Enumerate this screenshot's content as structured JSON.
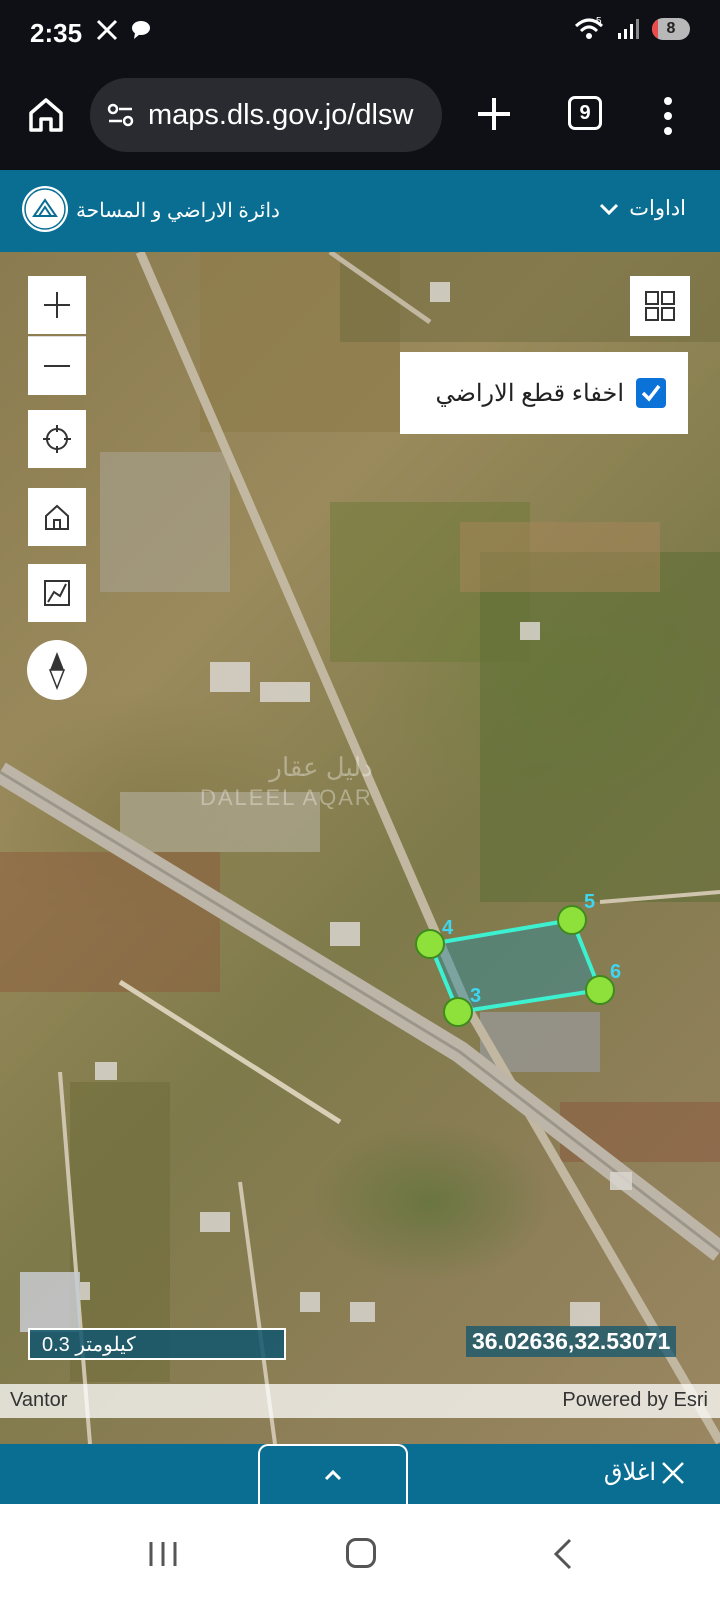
{
  "status_bar": {
    "time": "2:35",
    "icons": [
      "x-icon",
      "chat-icon"
    ],
    "wifi_label": "5",
    "battery": "8"
  },
  "browser": {
    "url": "maps.dls.gov.jo/dlsw",
    "tab_count": "9"
  },
  "header": {
    "department_name": "دائرة الاراضي و المساحة",
    "tools_label": "اداوات"
  },
  "map": {
    "layer_toggle": {
      "label": "اخفاء قطع الاراضي",
      "checked": true
    },
    "parcel_vertices": [
      "4",
      "5",
      "6",
      "3"
    ],
    "watermark_ar": "دليل عقار",
    "watermark_en": "DALEEL AQAR",
    "scale_label": "0.3 كيلومتر",
    "coordinates": "36.02636,32.53071",
    "attribution_left": "Vantor",
    "attribution_right": "Powered by Esri"
  },
  "bottom_panel": {
    "close_label": "اغلاق"
  },
  "colors": {
    "header_blue": "#0a6e93",
    "parcel_outline": "#3cf0d0",
    "vertex_green": "#8ee03a",
    "label_cyan": "#3fd6f0"
  }
}
